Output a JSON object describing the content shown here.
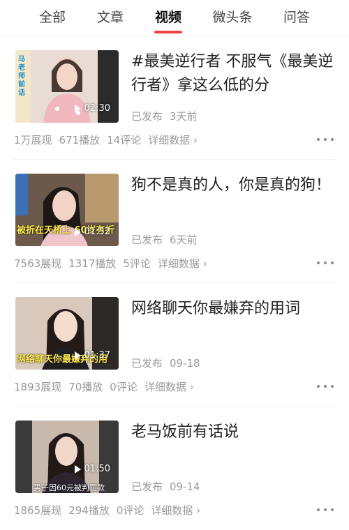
{
  "tabs": [
    "全部",
    "文章",
    "视频",
    "微头条",
    "问答"
  ],
  "active_tab": "视频",
  "colors": {
    "accent": "#f04142",
    "meta": "#999999"
  },
  "videos": [
    {
      "title": "#最美逆行者 不服气《最美逆行者》拿这么低的分",
      "duration": "02:30",
      "published_label": "已发布",
      "published_time": "3天前",
      "impressions": "1万展现",
      "plays": "671播放",
      "comments": "14评论",
      "details": "详细数据 ›",
      "thumb_caption": "马老师前话"
    },
    {
      "title": "狗不是真的人，你是真的狗！",
      "duration": "01:52",
      "published_label": "已发布",
      "published_time": "6天前",
      "impressions": "7563展现",
      "plays": "1317播放",
      "comments": "5评论",
      "details": "详细数据 ›",
      "thumb_caption": "被折在天桥上 60岁有折"
    },
    {
      "title": "网络聊天你最嫌弃的用词",
      "duration": "01:37",
      "published_label": "已发布",
      "published_time": "09-18",
      "impressions": "1893展现",
      "plays": "70播放",
      "comments": "0评论",
      "details": "详细数据 ›",
      "thumb_caption": "网络聊天你最嫌弃的用"
    },
    {
      "title": "老马饭前有话说",
      "duration": "01:50",
      "published_label": "已发布",
      "published_time": "09-14",
      "impressions": "1865展现",
      "plays": "294播放",
      "comments": "0评论",
      "details": "详细数据 ›",
      "thumb_caption": "男子因60元被判罚款"
    }
  ]
}
